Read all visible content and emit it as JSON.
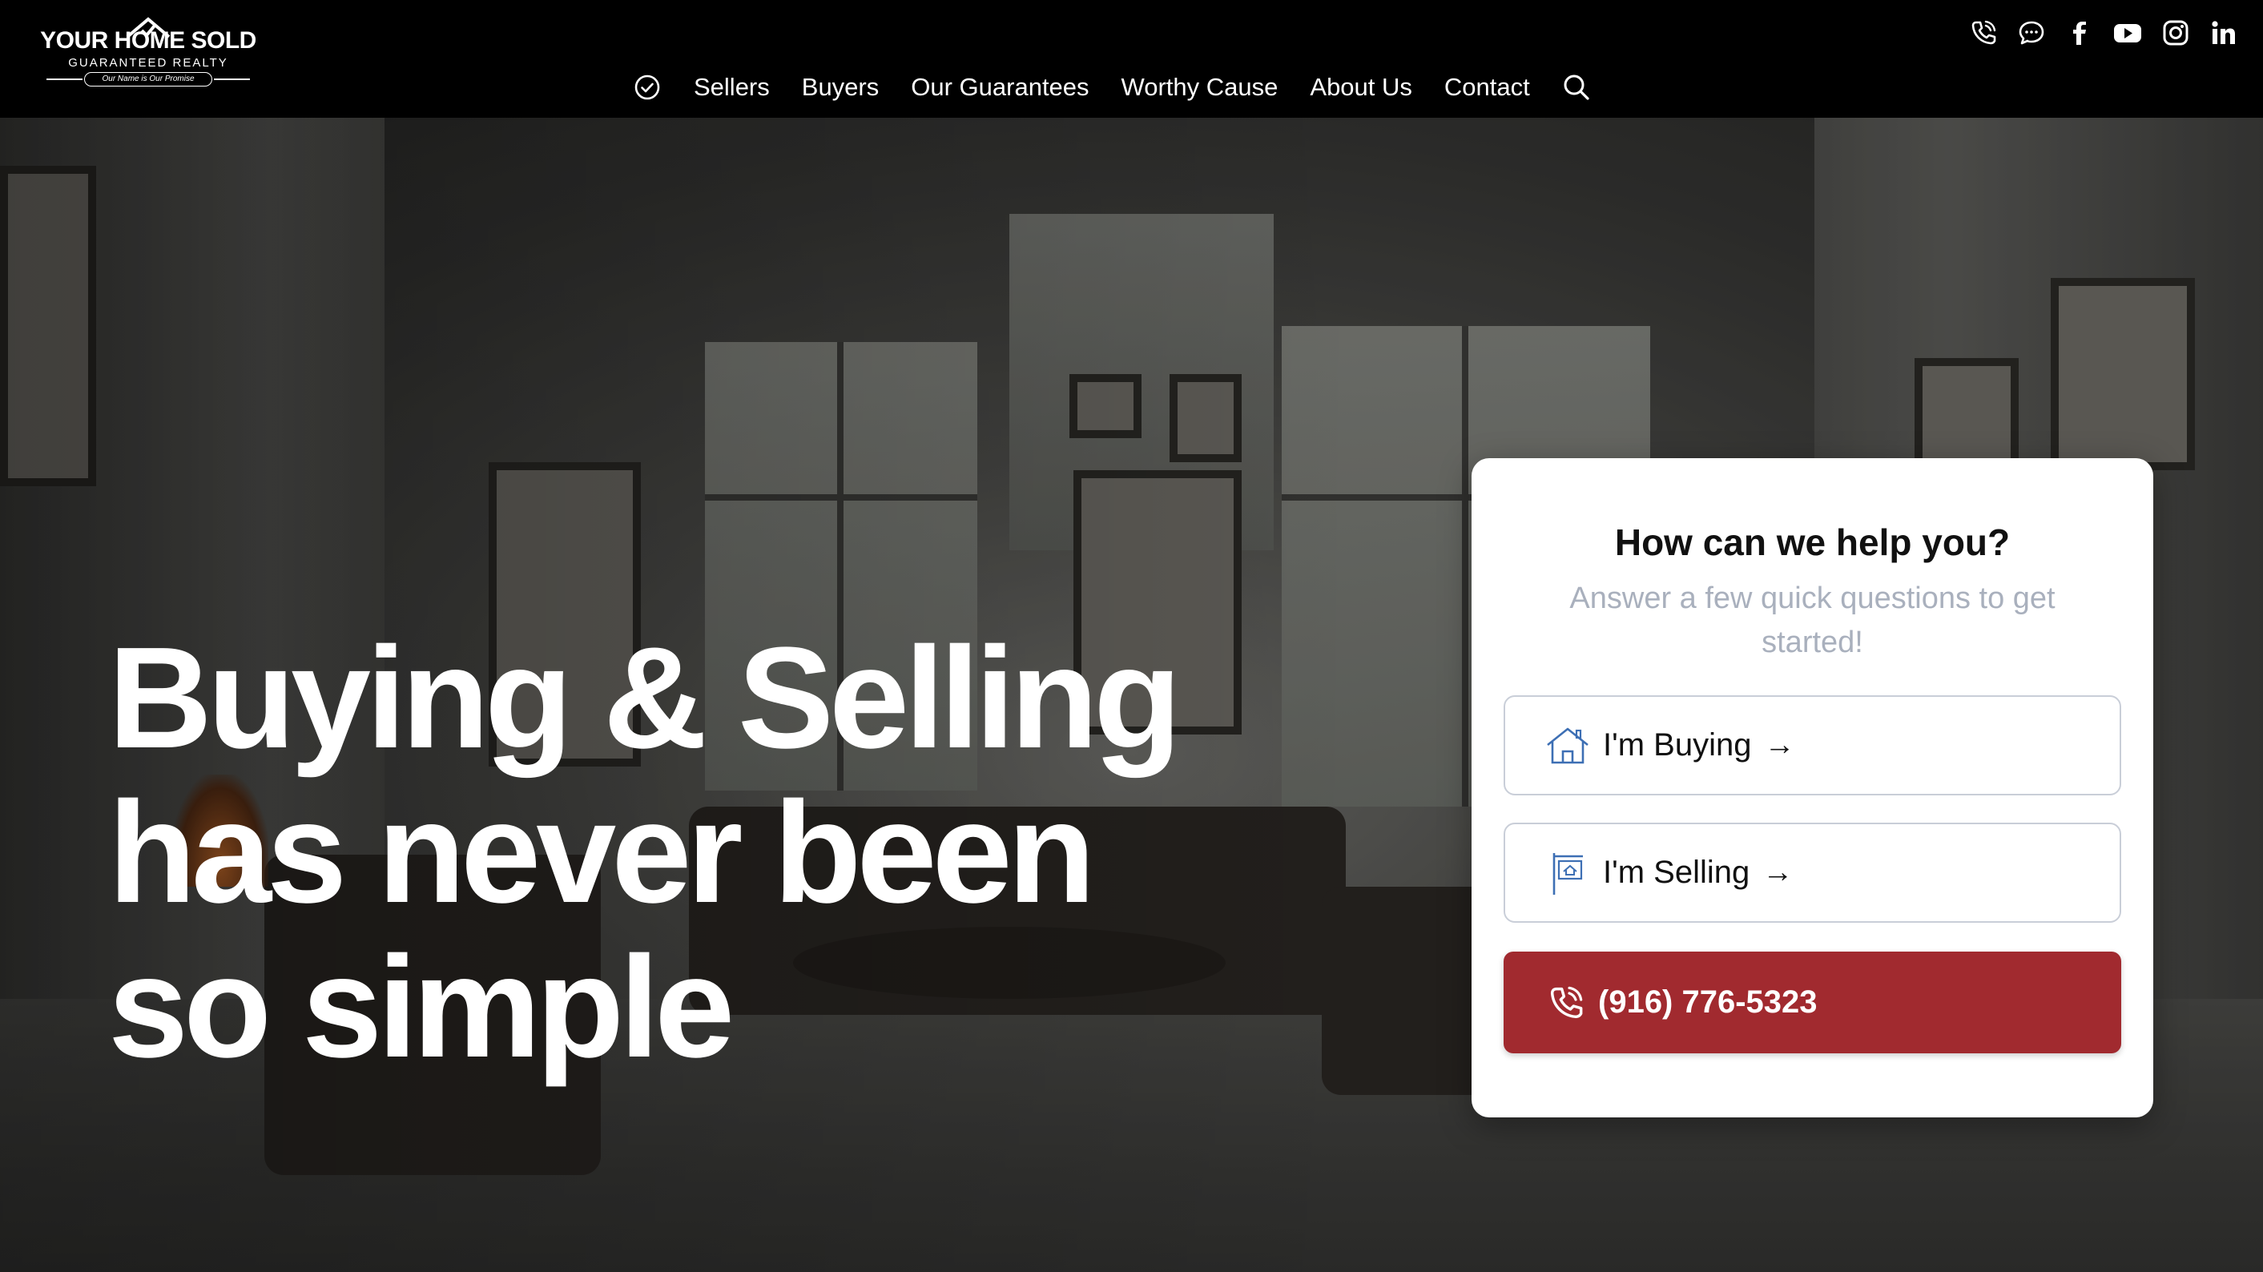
{
  "brand": {
    "logo_line1": "YOUR HOME SOLD",
    "logo_line2": "GUARANTEED REALTY",
    "logo_tagline": "Our Name is Our Promise"
  },
  "nav": {
    "icon": "check-circle-icon",
    "items": [
      "Sellers",
      "Buyers",
      "Our Guarantees",
      "Worthy Cause",
      "About Us",
      "Contact"
    ],
    "search_icon": "search-icon"
  },
  "social": [
    "phone-icon",
    "chat-icon",
    "facebook-icon",
    "youtube-icon",
    "instagram-icon",
    "linkedin-icon"
  ],
  "hero": {
    "headline_lines": [
      "Buying & Selling",
      "has never been",
      "so simple"
    ]
  },
  "card": {
    "title": "How can we help you?",
    "subtitle": "Answer a few quick questions to get started!",
    "options": [
      {
        "label": "I'm Buying",
        "icon": "house-icon",
        "arrow": "→"
      },
      {
        "label": "I'm Selling",
        "icon": "for-sale-sign-icon",
        "arrow": "→"
      }
    ],
    "phone": {
      "label": "(916) 776-5323",
      "icon": "phone-icon"
    }
  },
  "colors": {
    "header_bg": "#000000",
    "accent_red": "#a12a2f",
    "subtitle_gray": "#a9b0bd",
    "icon_blue": "#3d6fb4"
  }
}
